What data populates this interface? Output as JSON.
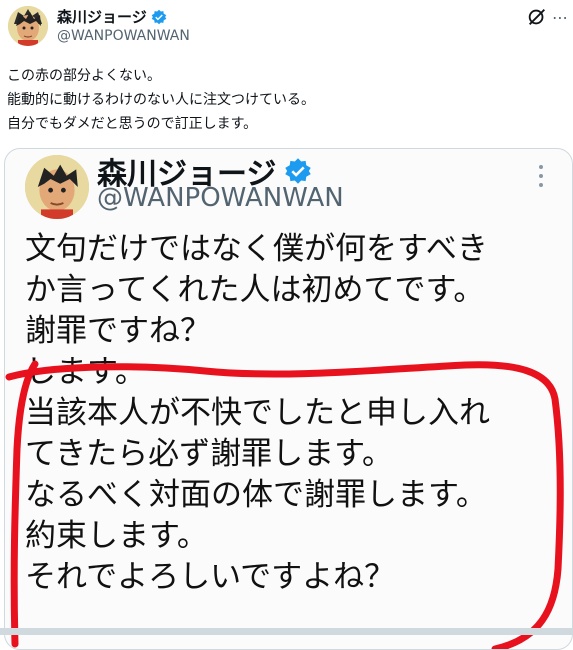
{
  "author": {
    "name": "森川ジョージ",
    "handle": "@WANPOWANWAN"
  },
  "tweet": {
    "lines": [
      "この赤の部分よくない。",
      "能動的に動けるわけのない人に注文つけている。",
      "自分でもダメだと思うので訂正します。"
    ]
  },
  "quoted": {
    "name": "森川ジョージ",
    "handle": "@WANPOWANWAN",
    "lines": [
      "文句だけではなく僕が何をすべき",
      "か言ってくれた人は初めてです。",
      "謝罪ですね？",
      "します。",
      "当該本人が不快でしたと申し入れ",
      "てきたら必ず謝罪します。",
      "なるべく対面の体で謝罪します。",
      "約束します。",
      "それでよろしいですよね？"
    ]
  },
  "colors": {
    "verified": "#1d9bf0",
    "annotation": "#e8121f",
    "secondary_text": "#536471"
  },
  "icons": {
    "verified": "verified-badge-icon",
    "grok": "grok-icon",
    "more": "more-icon"
  }
}
